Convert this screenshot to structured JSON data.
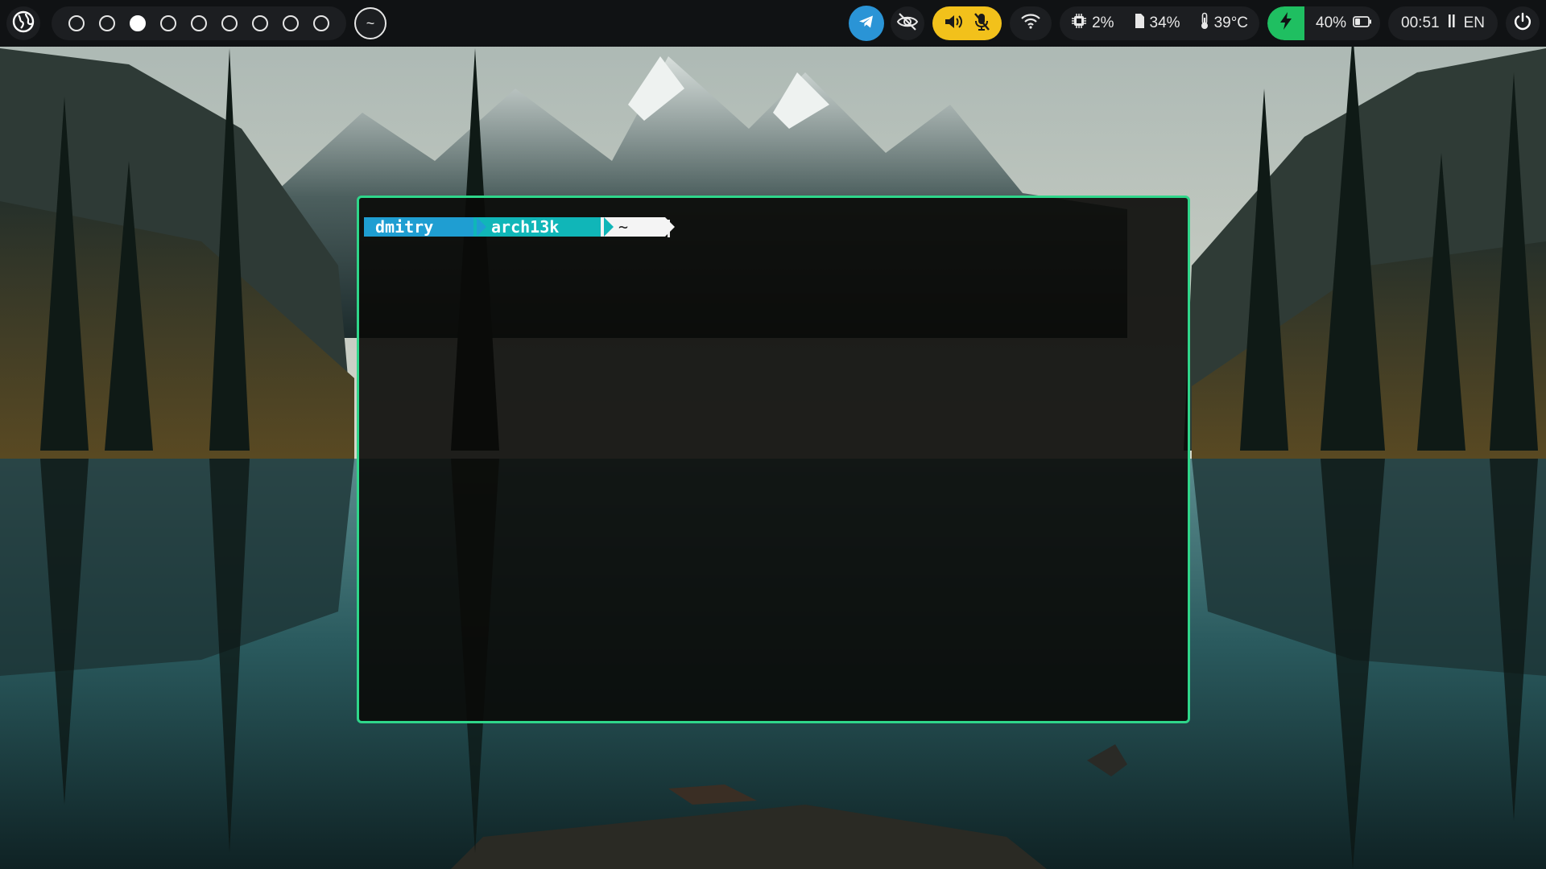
{
  "topbar": {
    "launcher_icon": "arch-globe-icon",
    "workspaces": [
      {
        "id": 1,
        "active": false
      },
      {
        "id": 2,
        "active": false
      },
      {
        "id": 3,
        "active": true
      },
      {
        "id": 4,
        "active": false
      },
      {
        "id": 5,
        "active": false
      },
      {
        "id": 6,
        "active": false
      },
      {
        "id": 7,
        "active": false
      },
      {
        "id": 8,
        "active": false
      },
      {
        "id": 9,
        "active": false
      }
    ],
    "scratchpad_label": "~",
    "tray": {
      "telegram_icon": "telegram-icon",
      "privacy_icon": "eye-off-icon",
      "volume_icon": "volume-icon",
      "mic_icon": "mic-muted-icon",
      "wifi_icon": "wifi-icon"
    },
    "system": {
      "cpu": "2%",
      "memory": "34%",
      "temperature": "39°C"
    },
    "battery": {
      "percent": "40%",
      "charging": true,
      "level": 0.4
    },
    "clock": {
      "time": "00:51",
      "layout": "EN"
    },
    "power_icon": "power-icon",
    "colors": {
      "bar_bg": "#101214",
      "pill_bg": "#1c1e21",
      "telegram": "#2a94d6",
      "audio": "#f2c11b",
      "charging": "#1fbf61"
    }
  },
  "terminal": {
    "prompt": {
      "user": "dmitry",
      "host": "arch13k",
      "dir": "~"
    },
    "border_color": "#2fd68a"
  }
}
